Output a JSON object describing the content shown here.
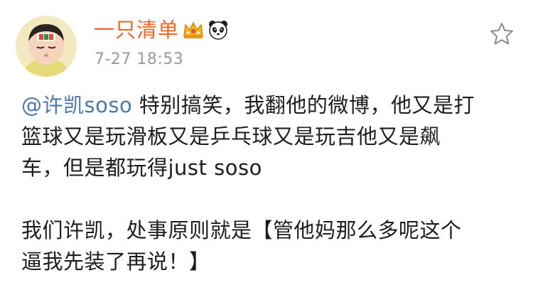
{
  "post": {
    "author": {
      "name": "一只清单",
      "badges": [
        "crown-badge",
        "panda-badge"
      ]
    },
    "timestamp": "7-27 18:53",
    "favorite_icon": "star-outline-icon",
    "mention": "@许凯soso",
    "paragraph1_rest": " 特别搞笑，我翻他的微博，他又是打",
    "paragraph1_line2": "篮球又是玩滑板又是乒乓球又是玩吉他又是飙",
    "paragraph1_line3": "车，但是都玩得just soso",
    "paragraph2_line1": "我们许凯，处事原则就是【管他妈那么多呢这个",
    "paragraph2_line2": "逼我先装了再说！】",
    "colors": {
      "username": "#eb6a26",
      "mention": "#4a78b0",
      "timestamp": "#9a9a9a",
      "text": "#1d1d1d"
    }
  }
}
